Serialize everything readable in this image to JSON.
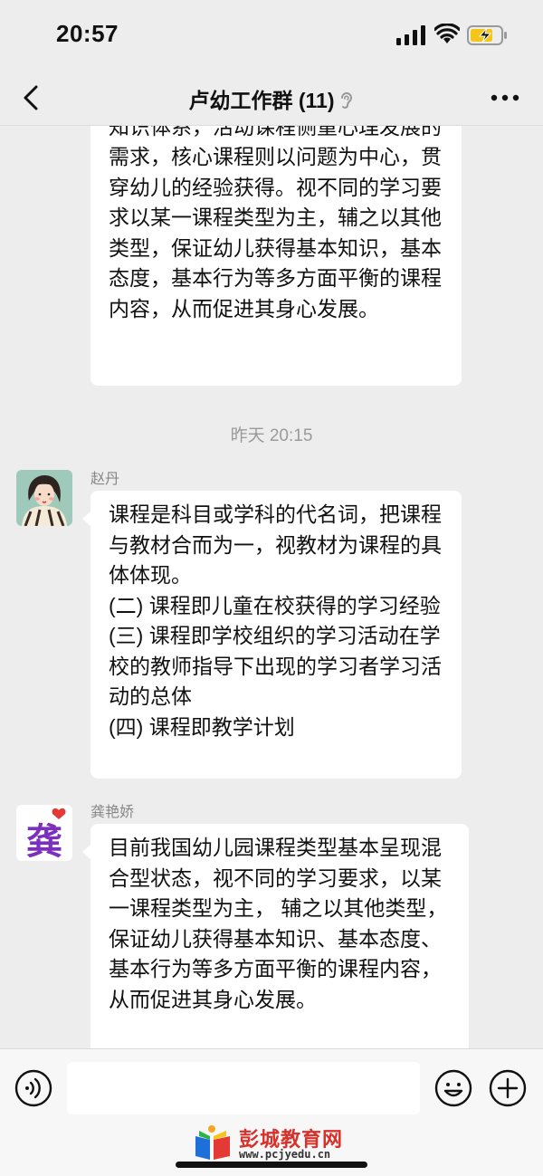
{
  "status_bar": {
    "time": "20:57"
  },
  "nav": {
    "title": "卢幼工作群 (11)"
  },
  "messages_top": {
    "text": "动课程二、核心课程。分科课程偏重知识体系，活动课程侧重心理发展的需求，核心课程则以问题为中心，贯穿幼儿的经验获得。视不同的学习要求以某一课程类型为主，辅之以其他类型，保证幼儿获得基本知识，基本态度，基本行为等多方面平衡的课程内容，从而促进其身心发展。"
  },
  "timestamp": "昨天 20:15",
  "messages": [
    {
      "sender": "赵丹",
      "text": "课程是科目或学科的代名词，把课程与教材合而为一，视教材为课程的具体体现。\n(二) 课程即儿童在校获得的学习经验\n(三) 课程即学校组织的学习活动在学校的教师指导下出现的学习者学习活动的总体\n(四) 课程即教学计划"
    },
    {
      "sender": "龚艳娇",
      "avatar_text": "龚",
      "text": "目前我国幼儿园课程类型基本呈现混合型状态，视不同的学习要求，以某一课程类型为主， 辅之以其他类型，保证幼儿获得基本知识、基本态度、基本行为等多方面平衡的课程内容，从而促进其身心发展。"
    }
  ],
  "watermark": {
    "title": "彭城教育网",
    "url": "www.pcjyedu.cn"
  },
  "colors": {
    "background": "#ededed",
    "bubble": "#ffffff",
    "accent_red": "#d8302a",
    "avatar_purple": "#7b2fbe"
  }
}
